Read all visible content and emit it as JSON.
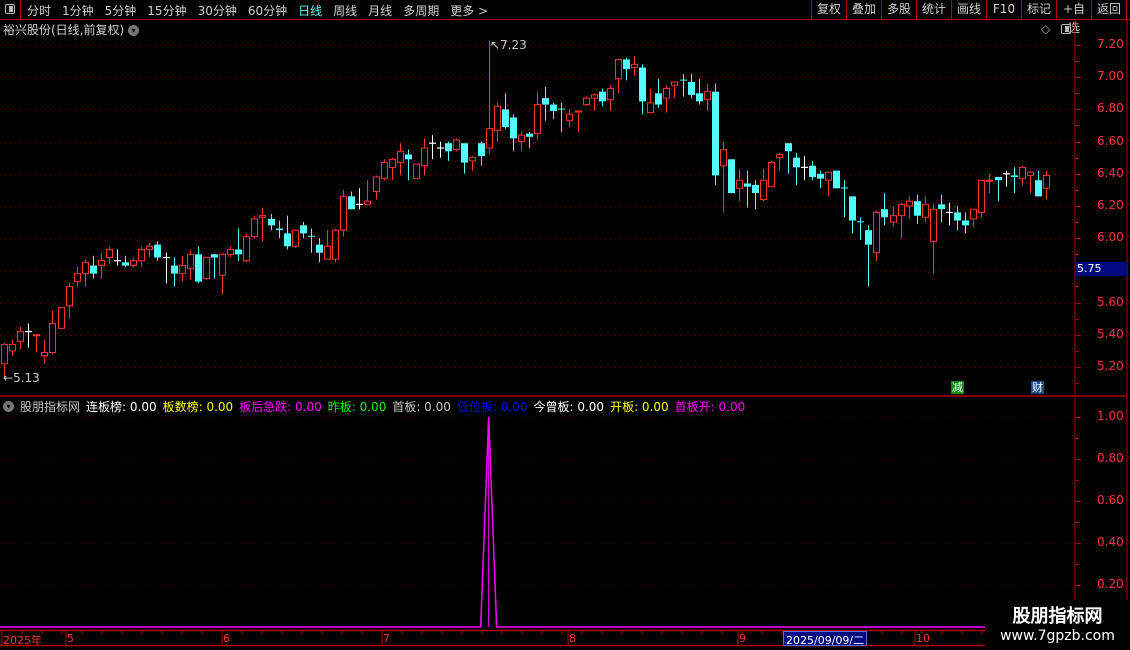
{
  "toolbar": {
    "periods": [
      "分时",
      "1分钟",
      "5分钟",
      "15分钟",
      "30分钟",
      "60分钟",
      "日线",
      "周线",
      "月线",
      "多周期",
      "更多 >"
    ],
    "active_period": "日线",
    "right_buttons": [
      "复权",
      "叠加",
      "多股",
      "统计",
      "画线",
      "F10",
      "标记",
      "+自选",
      "返回"
    ]
  },
  "chart_header": {
    "title": "裕兴股份(日线,前复权)"
  },
  "price_axis": {
    "labels": [
      "7.20",
      "7.00",
      "6.80",
      "6.60",
      "6.40",
      "6.20",
      "6.00",
      "5.60",
      "5.40",
      "5.20"
    ],
    "highlight_value": "5.75",
    "max_marker": "7.23",
    "min_marker": "5.13"
  },
  "badges": [
    {
      "text": "减",
      "color": "#0a8a0a"
    },
    {
      "text": "财",
      "color": "#1a4a8a"
    }
  ],
  "indicator": {
    "name": "股朋指标网",
    "items": [
      {
        "label": "连板榜: 0.00",
        "color": "#ffffff"
      },
      {
        "label": "板数榜: 0.00",
        "color": "#ffff00"
      },
      {
        "label": "板后急跌: 0.00",
        "color": "#ff00ff"
      },
      {
        "label": "昨板: 0.00",
        "color": "#00ff00"
      },
      {
        "label": "首板: 0.00",
        "color": "#c8c8c8"
      },
      {
        "label": "低位板: 0.00",
        "color": "#0000ff"
      },
      {
        "label": "今曾板: 0.00",
        "color": "#ffffff"
      },
      {
        "label": "开板: 0.00",
        "color": "#ffff00"
      },
      {
        "label": "首板开: 0.00",
        "color": "#ff00ff"
      }
    ],
    "axis_labels": [
      "1.00",
      "0.80",
      "0.60",
      "0.40",
      "0.20"
    ]
  },
  "date_axis": {
    "labels": [
      {
        "text": "2025年"
      },
      {
        "text": "5"
      },
      {
        "text": "6"
      },
      {
        "text": "7"
      },
      {
        "text": "8"
      },
      {
        "text": "9"
      },
      {
        "text": "10"
      }
    ],
    "highlight": "2025/09/09/二"
  },
  "watermark": {
    "line1": "股朋指标网",
    "line2": "www.7gpzb.com"
  },
  "colors": {
    "up": "#ff3232",
    "down": "#54ffff",
    "doji": "#ffffff",
    "grid": "#7a0000",
    "indicator": "#ff00ff",
    "frame": "#b00000"
  },
  "chart_data": [
    {
      "type": "candlestick",
      "ylim": [
        5.1,
        7.26
      ],
      "ohlc": [
        [
          5.22,
          5.35,
          5.13,
          5.34
        ],
        [
          5.3,
          5.37,
          5.27,
          5.34
        ],
        [
          5.36,
          5.45,
          5.31,
          5.42
        ],
        [
          5.42,
          5.47,
          5.32,
          5.42
        ],
        [
          5.395,
          5.4,
          5.29,
          5.4
        ],
        [
          5.27,
          5.37,
          5.22,
          5.29
        ],
        [
          5.29,
          5.55,
          5.28,
          5.47
        ],
        [
          5.44,
          5.57,
          5.44,
          5.57
        ],
        [
          5.58,
          5.72,
          5.5,
          5.7
        ],
        [
          5.73,
          5.82,
          5.7,
          5.78
        ],
        [
          5.78,
          5.87,
          5.7,
          5.85
        ],
        [
          5.83,
          5.89,
          5.75,
          5.78
        ],
        [
          5.83,
          5.91,
          5.75,
          5.86
        ],
        [
          5.88,
          5.95,
          5.84,
          5.93
        ],
        [
          5.86,
          5.93,
          5.83,
          5.86
        ],
        [
          5.85,
          5.89,
          5.82,
          5.83
        ],
        [
          5.83,
          5.88,
          5.82,
          5.86
        ],
        [
          5.86,
          5.95,
          5.82,
          5.93
        ],
        [
          5.93,
          5.97,
          5.88,
          5.95
        ],
        [
          5.96,
          5.98,
          5.86,
          5.88
        ],
        [
          5.88,
          5.91,
          5.72,
          5.88
        ],
        [
          5.83,
          5.88,
          5.7,
          5.78
        ],
        [
          5.78,
          5.89,
          5.73,
          5.83
        ],
        [
          5.81,
          5.93,
          5.74,
          5.9
        ],
        [
          5.9,
          5.95,
          5.72,
          5.73
        ],
        [
          5.75,
          5.88,
          5.74,
          5.88
        ],
        [
          5.9,
          5.9,
          5.75,
          5.88
        ],
        [
          5.77,
          5.91,
          5.65,
          5.9
        ],
        [
          5.9,
          5.95,
          5.88,
          5.93
        ],
        [
          5.93,
          6.06,
          5.86,
          5.9
        ],
        [
          5.86,
          6.03,
          5.85,
          6.01
        ],
        [
          6.01,
          6.14,
          6.0,
          6.12
        ],
        [
          6.13,
          6.19,
          5.98,
          6.14
        ],
        [
          6.12,
          6.15,
          6.05,
          6.08
        ],
        [
          6.06,
          6.11,
          6.0,
          6.05
        ],
        [
          6.03,
          6.14,
          5.93,
          5.95
        ],
        [
          5.95,
          6.05,
          5.94,
          6.05
        ],
        [
          6.08,
          6.1,
          6.0,
          6.03
        ],
        [
          6.015,
          6.06,
          5.91,
          6.01
        ],
        [
          5.96,
          6.0,
          5.85,
          5.91
        ],
        [
          5.87,
          6.05,
          5.87,
          5.95
        ],
        [
          5.87,
          6.06,
          5.85,
          6.05
        ],
        [
          6.05,
          6.3,
          6.01,
          6.26
        ],
        [
          6.26,
          6.29,
          6.18,
          6.18
        ],
        [
          6.21,
          6.31,
          6.18,
          6.21
        ],
        [
          6.21,
          6.36,
          6.21,
          6.23
        ],
        [
          6.29,
          6.39,
          6.24,
          6.38
        ],
        [
          6.37,
          6.49,
          6.36,
          6.47
        ],
        [
          6.44,
          6.5,
          6.36,
          6.49
        ],
        [
          6.47,
          6.59,
          6.39,
          6.54
        ],
        [
          6.52,
          6.55,
          6.36,
          6.49
        ],
        [
          6.37,
          6.46,
          6.37,
          6.46
        ],
        [
          6.45,
          6.62,
          6.39,
          6.56
        ],
        [
          6.59,
          6.64,
          6.49,
          6.59
        ],
        [
          6.56,
          6.6,
          6.5,
          6.56
        ],
        [
          6.59,
          6.6,
          6.48,
          6.54
        ],
        [
          6.55,
          6.62,
          6.54,
          6.61
        ],
        [
          6.59,
          6.59,
          6.4,
          6.47
        ],
        [
          6.48,
          6.51,
          6.42,
          6.5
        ],
        [
          6.59,
          6.6,
          6.45,
          6.51
        ],
        [
          6.56,
          7.23,
          6.52,
          6.68
        ],
        [
          6.67,
          6.84,
          6.6,
          6.82
        ],
        [
          6.8,
          6.9,
          6.68,
          6.69
        ],
        [
          6.75,
          6.77,
          6.54,
          6.62
        ],
        [
          6.6,
          6.66,
          6.54,
          6.64
        ],
        [
          6.65,
          6.66,
          6.56,
          6.63
        ],
        [
          6.65,
          6.91,
          6.61,
          6.83
        ],
        [
          6.87,
          6.94,
          6.73,
          6.83
        ],
        [
          6.83,
          6.84,
          6.74,
          6.79
        ],
        [
          6.805,
          6.84,
          6.66,
          6.8
        ],
        [
          6.73,
          6.8,
          6.69,
          6.77
        ],
        [
          6.785,
          6.79,
          6.66,
          6.79
        ],
        [
          6.83,
          6.88,
          6.82,
          6.87
        ],
        [
          6.87,
          6.9,
          6.79,
          6.89
        ],
        [
          6.91,
          6.93,
          6.82,
          6.85
        ],
        [
          6.86,
          6.95,
          6.79,
          6.93
        ],
        [
          6.99,
          7.11,
          6.9,
          7.11
        ],
        [
          7.11,
          7.12,
          6.98,
          7.05
        ],
        [
          7.06,
          7.13,
          7.01,
          7.08
        ],
        [
          7.06,
          7.08,
          6.77,
          6.85
        ],
        [
          6.78,
          6.93,
          6.78,
          6.84
        ],
        [
          6.9,
          6.99,
          6.81,
          6.83
        ],
        [
          6.87,
          6.95,
          6.78,
          6.93
        ],
        [
          6.95,
          6.97,
          6.87,
          6.97
        ],
        [
          6.985,
          7.02,
          6.88,
          6.98
        ],
        [
          6.97,
          7.02,
          6.87,
          6.89
        ],
        [
          6.9,
          6.99,
          6.83,
          6.85
        ],
        [
          6.86,
          6.96,
          6.79,
          6.91
        ],
        [
          6.91,
          6.96,
          6.33,
          6.39
        ],
        [
          6.45,
          6.6,
          6.16,
          6.55
        ],
        [
          6.49,
          6.49,
          6.28,
          6.28
        ],
        [
          6.31,
          6.43,
          6.23,
          6.36
        ],
        [
          6.34,
          6.42,
          6.19,
          6.32
        ],
        [
          6.33,
          6.36,
          6.18,
          6.28
        ],
        [
          6.24,
          6.43,
          6.23,
          6.36
        ],
        [
          6.32,
          6.48,
          6.32,
          6.47
        ],
        [
          6.5,
          6.53,
          6.42,
          6.52
        ],
        [
          6.59,
          6.59,
          6.4,
          6.54
        ],
        [
          6.5,
          6.53,
          6.33,
          6.44
        ],
        [
          6.44,
          6.51,
          6.36,
          6.44
        ],
        [
          6.45,
          6.48,
          6.36,
          6.38
        ],
        [
          6.4,
          6.42,
          6.31,
          6.37
        ],
        [
          6.36,
          6.41,
          6.26,
          6.41
        ],
        [
          6.42,
          6.42,
          6.31,
          6.31
        ],
        [
          6.315,
          6.36,
          6.13,
          6.31
        ],
        [
          6.26,
          6.26,
          6.03,
          6.11
        ],
        [
          6.105,
          6.13,
          5.99,
          6.1
        ],
        [
          6.05,
          6.08,
          5.7,
          5.96
        ],
        [
          5.91,
          6.17,
          5.86,
          6.16
        ],
        [
          6.18,
          6.28,
          6.08,
          6.13
        ],
        [
          6.1,
          6.2,
          6.07,
          6.14
        ],
        [
          6.14,
          6.22,
          6.0,
          6.21
        ],
        [
          6.2,
          6.26,
          6.12,
          6.23
        ],
        [
          6.23,
          6.27,
          6.09,
          6.14
        ],
        [
          6.13,
          6.26,
          6.1,
          6.21
        ],
        [
          5.98,
          6.21,
          5.78,
          6.18
        ],
        [
          6.21,
          6.27,
          6.1,
          6.18
        ],
        [
          6.16,
          6.22,
          6.08,
          6.16
        ],
        [
          6.16,
          6.2,
          6.05,
          6.11
        ],
        [
          6.11,
          6.16,
          6.03,
          6.08
        ],
        [
          6.12,
          6.18,
          6.07,
          6.18
        ],
        [
          6.16,
          6.36,
          6.13,
          6.36
        ],
        [
          6.355,
          6.4,
          6.28,
          6.36
        ],
        [
          6.38,
          6.38,
          6.23,
          6.36
        ],
        [
          6.4,
          6.42,
          6.32,
          6.4
        ],
        [
          6.39,
          6.44,
          6.28,
          6.38
        ],
        [
          6.37,
          6.45,
          6.33,
          6.44
        ],
        [
          6.39,
          6.42,
          6.28,
          6.41
        ],
        [
          6.36,
          6.42,
          6.26,
          6.26
        ],
        [
          6.31,
          6.42,
          6.24,
          6.39
        ]
      ]
    },
    {
      "type": "line",
      "ylim": [
        0,
        1.0
      ],
      "values": [
        0,
        0,
        0,
        0,
        0,
        0,
        0,
        0,
        0,
        0,
        0,
        0,
        0,
        0,
        0,
        0,
        0,
        0,
        0,
        0,
        0,
        0,
        0,
        0,
        0,
        0,
        0,
        0,
        0,
        0,
        0,
        0,
        0,
        0,
        0,
        0,
        0,
        0,
        0,
        0,
        0,
        0,
        0,
        0,
        0,
        0,
        0,
        0,
        0,
        0,
        0,
        0,
        0,
        0,
        0,
        0,
        0,
        0,
        0,
        0,
        1,
        0,
        0,
        0,
        0,
        0,
        0,
        0,
        0,
        0,
        0,
        0,
        0,
        0,
        0,
        0,
        0,
        0,
        0,
        0,
        0,
        0,
        0,
        0,
        0,
        0,
        0,
        0,
        0,
        0,
        0,
        0,
        0,
        0,
        0,
        0,
        0,
        0,
        0,
        0,
        0,
        0,
        0,
        0,
        0,
        0,
        0,
        0,
        0,
        0,
        0,
        0,
        0,
        0,
        0,
        0,
        0,
        0,
        0,
        0,
        0,
        0,
        0,
        0,
        0,
        0,
        0,
        0,
        0,
        0
      ]
    }
  ]
}
